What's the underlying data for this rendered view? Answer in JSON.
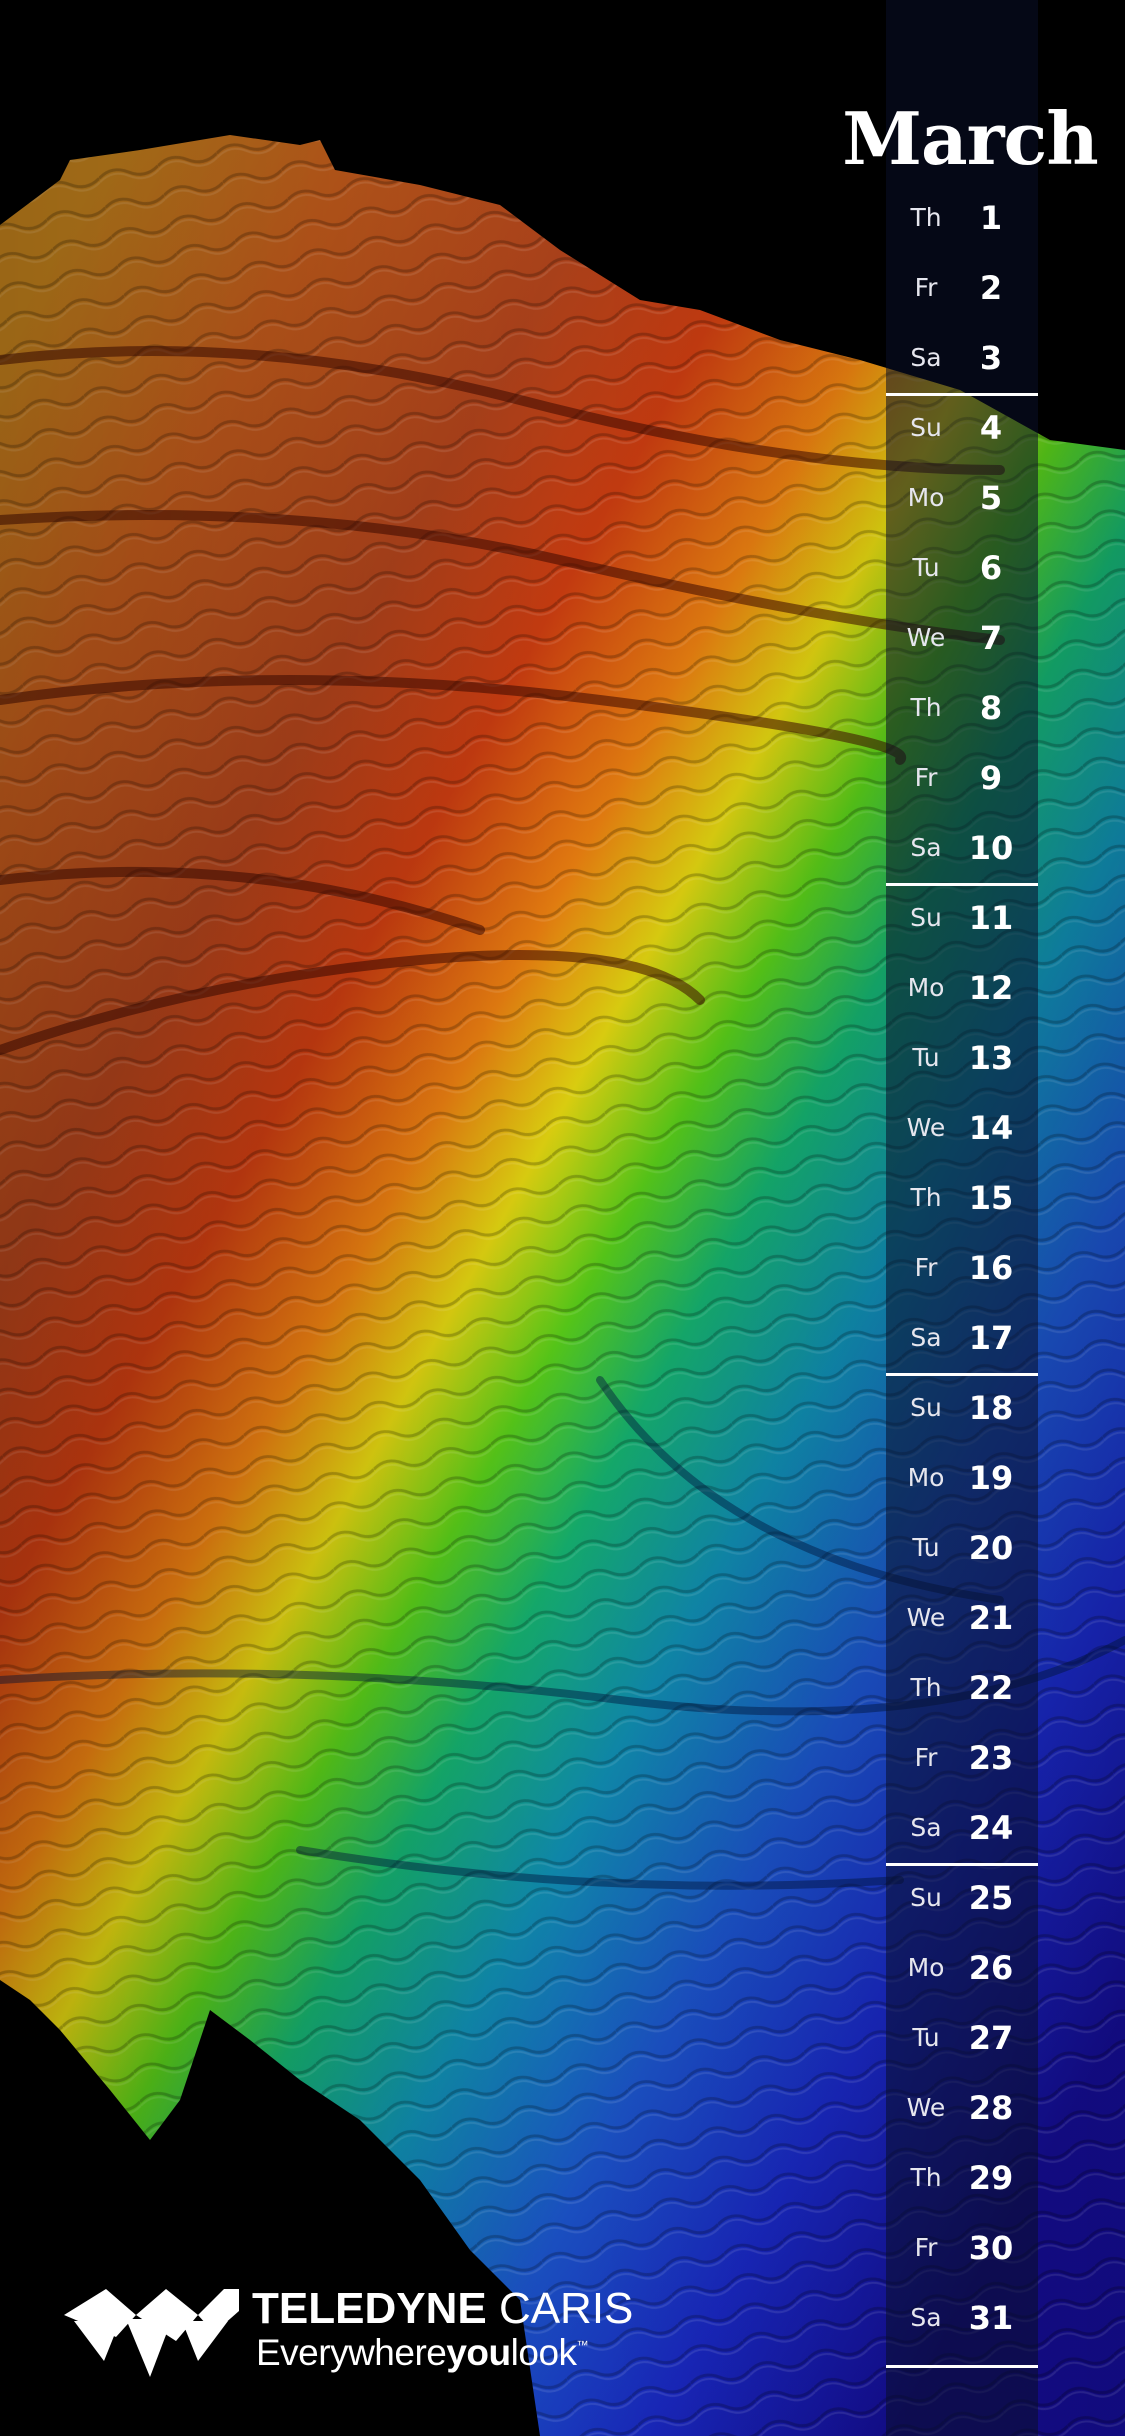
{
  "calendar": {
    "month": "March",
    "days": [
      {
        "dow": "Th",
        "num": "1"
      },
      {
        "dow": "Fr",
        "num": "2"
      },
      {
        "dow": "Sa",
        "num": "3"
      },
      {
        "dow": "Su",
        "num": "4"
      },
      {
        "dow": "Mo",
        "num": "5"
      },
      {
        "dow": "Tu",
        "num": "6"
      },
      {
        "dow": "We",
        "num": "7"
      },
      {
        "dow": "Th",
        "num": "8"
      },
      {
        "dow": "Fr",
        "num": "9"
      },
      {
        "dow": "Sa",
        "num": "10"
      },
      {
        "dow": "Su",
        "num": "11"
      },
      {
        "dow": "Mo",
        "num": "12"
      },
      {
        "dow": "Tu",
        "num": "13"
      },
      {
        "dow": "We",
        "num": "14"
      },
      {
        "dow": "Th",
        "num": "15"
      },
      {
        "dow": "Fr",
        "num": "16"
      },
      {
        "dow": "Sa",
        "num": "17"
      },
      {
        "dow": "Su",
        "num": "18"
      },
      {
        "dow": "Mo",
        "num": "19"
      },
      {
        "dow": "Tu",
        "num": "20"
      },
      {
        "dow": "We",
        "num": "21"
      },
      {
        "dow": "Th",
        "num": "22"
      },
      {
        "dow": "Fr",
        "num": "23"
      },
      {
        "dow": "Sa",
        "num": "24"
      },
      {
        "dow": "Su",
        "num": "25"
      },
      {
        "dow": "Mo",
        "num": "26"
      },
      {
        "dow": "Tu",
        "num": "27"
      },
      {
        "dow": "We",
        "num": "28"
      },
      {
        "dow": "Th",
        "num": "29"
      },
      {
        "dow": "Fr",
        "num": "30"
      },
      {
        "dow": "Sa",
        "num": "31"
      }
    ]
  },
  "branding": {
    "name_bold": "TELEDYNE",
    "name_light": "CARIS",
    "tagline_1": "Everywhere",
    "tagline_2": "you",
    "tagline_3": "look",
    "tagline_tm": "™"
  },
  "colors": {
    "background": "#000000",
    "strip": "#0a0e28",
    "text": "#ffffff"
  },
  "icons": {
    "logo": "teledyne-arrows-logo-icon"
  }
}
